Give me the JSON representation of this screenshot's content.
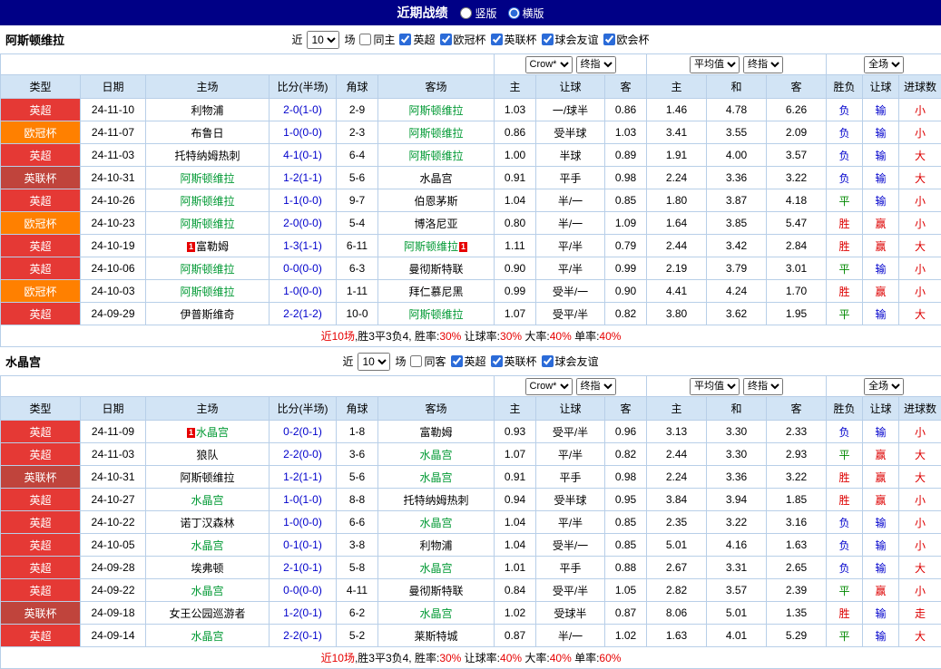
{
  "top_bar": {
    "title": "近期战绩",
    "radios": [
      {
        "label": "竖版",
        "selected": false
      },
      {
        "label": "横版",
        "selected": true
      }
    ]
  },
  "table_columns": {
    "type": "类型",
    "date": "日期",
    "home": "主场",
    "score": "比分(半场)",
    "corners": "角球",
    "away": "客场",
    "handicap_group": [
      "主",
      "让球",
      "客"
    ],
    "europe_group": [
      "主",
      "和",
      "客"
    ],
    "result_group": [
      "胜负",
      "让球",
      "进球数"
    ]
  },
  "colors": {
    "leagues": {
      "英超": "#e53935",
      "欧冠杯": "#ff8000",
      "英联杯": "#c0443c"
    },
    "focus_team_green": "#009933",
    "score_blue": "#0000cc",
    "win_red": "#dd0000",
    "draw_green": "#008800",
    "lose_blue": "#0000cc",
    "red_text": "#e60000",
    "topbar_navy": "#000086",
    "header_blue": "#d2e4f5"
  },
  "sections": [
    {
      "team": "阿斯顿维拉",
      "filter": {
        "prefix": "近",
        "count": "10",
        "suffix": "场",
        "same_option": {
          "label": "同主",
          "checked": false
        },
        "leagues": [
          {
            "label": "英超",
            "checked": true
          },
          {
            "label": "欧冠杯",
            "checked": true
          },
          {
            "label": "英联杯",
            "checked": true
          },
          {
            "label": "球会友谊",
            "checked": true
          },
          {
            "label": "欧会杯",
            "checked": true
          }
        ]
      },
      "selects": {
        "handicap_company": "Crow*",
        "handicap_stage": "终指",
        "europe_company": "平均值",
        "europe_stage": "终指",
        "scope": "全场"
      },
      "rows": [
        {
          "league": "英超",
          "date": "24-11-10",
          "home": {
            "name": "利物浦"
          },
          "score": "2-0(1-0)",
          "corners": "2-9",
          "away": {
            "name": "阿斯顿维拉",
            "focus": true
          },
          "handicap": [
            "1.03",
            "一/球半",
            "0.86"
          ],
          "europe": [
            "1.46",
            "4.78",
            "6.26"
          ],
          "result": [
            [
              "负",
              "b"
            ],
            [
              "输",
              "b"
            ],
            [
              "小",
              "r"
            ]
          ]
        },
        {
          "league": "欧冠杯",
          "date": "24-11-07",
          "home": {
            "name": "布鲁日"
          },
          "score": "1-0(0-0)",
          "corners": "2-3",
          "away": {
            "name": "阿斯顿维拉",
            "focus": true
          },
          "handicap": [
            "0.86",
            "受半球",
            "1.03"
          ],
          "europe": [
            "3.41",
            "3.55",
            "2.09"
          ],
          "result": [
            [
              "负",
              "b"
            ],
            [
              "输",
              "b"
            ],
            [
              "小",
              "r"
            ]
          ]
        },
        {
          "league": "英超",
          "date": "24-11-03",
          "home": {
            "name": "托特纳姆热刺"
          },
          "score": "4-1(0-1)",
          "corners": "6-4",
          "away": {
            "name": "阿斯顿维拉",
            "focus": true
          },
          "handicap": [
            "1.00",
            "半球",
            "0.89"
          ],
          "europe": [
            "1.91",
            "4.00",
            "3.57"
          ],
          "result": [
            [
              "负",
              "b"
            ],
            [
              "输",
              "b"
            ],
            [
              "大",
              "r"
            ]
          ]
        },
        {
          "league": "英联杯",
          "date": "24-10-31",
          "home": {
            "name": "阿斯顿维拉",
            "focus": true
          },
          "score": "1-2(1-1)",
          "corners": "5-6",
          "away": {
            "name": "水晶宫"
          },
          "handicap": [
            "0.91",
            "平手",
            "0.98"
          ],
          "europe": [
            "2.24",
            "3.36",
            "3.22"
          ],
          "result": [
            [
              "负",
              "b"
            ],
            [
              "输",
              "b"
            ],
            [
              "大",
              "r"
            ]
          ]
        },
        {
          "league": "英超",
          "date": "24-10-26",
          "home": {
            "name": "阿斯顿维拉",
            "focus": true
          },
          "score": "1-1(0-0)",
          "corners": "9-7",
          "away": {
            "name": "伯恩茅斯"
          },
          "handicap": [
            "1.04",
            "半/一",
            "0.85"
          ],
          "europe": [
            "1.80",
            "3.87",
            "4.18"
          ],
          "result": [
            [
              "平",
              "g"
            ],
            [
              "输",
              "b"
            ],
            [
              "小",
              "r"
            ]
          ]
        },
        {
          "league": "欧冠杯",
          "date": "24-10-23",
          "home": {
            "name": "阿斯顿维拉",
            "focus": true
          },
          "score": "2-0(0-0)",
          "corners": "5-4",
          "away": {
            "name": "博洛尼亚"
          },
          "handicap": [
            "0.80",
            "半/一",
            "1.09"
          ],
          "europe": [
            "1.64",
            "3.85",
            "5.47"
          ],
          "result": [
            [
              "胜",
              "r"
            ],
            [
              "赢",
              "r"
            ],
            [
              "小",
              "r"
            ]
          ]
        },
        {
          "league": "英超",
          "date": "24-10-19",
          "home": {
            "name": "富勒姆",
            "card": "before"
          },
          "score": "1-3(1-1)",
          "corners": "6-11",
          "away": {
            "name": "阿斯顿维拉",
            "focus": true,
            "card": "after"
          },
          "handicap": [
            "1.11",
            "平/半",
            "0.79"
          ],
          "europe": [
            "2.44",
            "3.42",
            "2.84"
          ],
          "result": [
            [
              "胜",
              "r"
            ],
            [
              "赢",
              "r"
            ],
            [
              "大",
              "r"
            ]
          ]
        },
        {
          "league": "英超",
          "date": "24-10-06",
          "home": {
            "name": "阿斯顿维拉",
            "focus": true
          },
          "score": "0-0(0-0)",
          "corners": "6-3",
          "away": {
            "name": "曼彻斯特联"
          },
          "handicap": [
            "0.90",
            "平/半",
            "0.99"
          ],
          "europe": [
            "2.19",
            "3.79",
            "3.01"
          ],
          "result": [
            [
              "平",
              "g"
            ],
            [
              "输",
              "b"
            ],
            [
              "小",
              "r"
            ]
          ]
        },
        {
          "league": "欧冠杯",
          "date": "24-10-03",
          "home": {
            "name": "阿斯顿维拉",
            "focus": true
          },
          "score": "1-0(0-0)",
          "corners": "1-11",
          "away": {
            "name": "拜仁慕尼黑"
          },
          "handicap": [
            "0.99",
            "受半/一",
            "0.90"
          ],
          "europe": [
            "4.41",
            "4.24",
            "1.70"
          ],
          "result": [
            [
              "胜",
              "r"
            ],
            [
              "赢",
              "r"
            ],
            [
              "小",
              "r"
            ]
          ]
        },
        {
          "league": "英超",
          "date": "24-09-29",
          "home": {
            "name": "伊普斯维奇"
          },
          "score": "2-2(1-2)",
          "corners": "10-0",
          "away": {
            "name": "阿斯顿维拉",
            "focus": true
          },
          "handicap": [
            "1.07",
            "受平/半",
            "0.82"
          ],
          "europe": [
            "3.80",
            "3.62",
            "1.95"
          ],
          "result": [
            [
              "平",
              "g"
            ],
            [
              "输",
              "b"
            ],
            [
              "大",
              "r"
            ]
          ]
        }
      ],
      "summary": [
        [
          "近10场",
          true
        ],
        [
          ",胜3平3负4, 胜率:",
          false
        ],
        [
          "30%",
          true
        ],
        [
          " 让球率:",
          false
        ],
        [
          "30%",
          true
        ],
        [
          " 大率:",
          false
        ],
        [
          "40%",
          true
        ],
        [
          " 单率:",
          false
        ],
        [
          "40%",
          true
        ]
      ]
    },
    {
      "team": "水晶宫",
      "filter": {
        "prefix": "近",
        "count": "10",
        "suffix": "场",
        "same_option": {
          "label": "同客",
          "checked": false
        },
        "leagues": [
          {
            "label": "英超",
            "checked": true
          },
          {
            "label": "英联杯",
            "checked": true
          },
          {
            "label": "球会友谊",
            "checked": true
          }
        ]
      },
      "selects": {
        "handicap_company": "Crow*",
        "handicap_stage": "终指",
        "europe_company": "平均值",
        "europe_stage": "终指",
        "scope": "全场"
      },
      "rows": [
        {
          "league": "英超",
          "date": "24-11-09",
          "home": {
            "name": "水晶宫",
            "focus": true,
            "card": "before"
          },
          "score": "0-2(0-1)",
          "corners": "1-8",
          "away": {
            "name": "富勒姆"
          },
          "handicap": [
            "0.93",
            "受平/半",
            "0.96"
          ],
          "europe": [
            "3.13",
            "3.30",
            "2.33"
          ],
          "result": [
            [
              "负",
              "b"
            ],
            [
              "输",
              "b"
            ],
            [
              "小",
              "r"
            ]
          ]
        },
        {
          "league": "英超",
          "date": "24-11-03",
          "home": {
            "name": "狼队"
          },
          "score": "2-2(0-0)",
          "corners": "3-6",
          "away": {
            "name": "水晶宫",
            "focus": true
          },
          "handicap": [
            "1.07",
            "平/半",
            "0.82"
          ],
          "europe": [
            "2.44",
            "3.30",
            "2.93"
          ],
          "result": [
            [
              "平",
              "g"
            ],
            [
              "赢",
              "r"
            ],
            [
              "大",
              "r"
            ]
          ]
        },
        {
          "league": "英联杯",
          "date": "24-10-31",
          "home": {
            "name": "阿斯顿维拉"
          },
          "score": "1-2(1-1)",
          "corners": "5-6",
          "away": {
            "name": "水晶宫",
            "focus": true
          },
          "handicap": [
            "0.91",
            "平手",
            "0.98"
          ],
          "europe": [
            "2.24",
            "3.36",
            "3.22"
          ],
          "result": [
            [
              "胜",
              "r"
            ],
            [
              "赢",
              "r"
            ],
            [
              "大",
              "r"
            ]
          ]
        },
        {
          "league": "英超",
          "date": "24-10-27",
          "home": {
            "name": "水晶宫",
            "focus": true
          },
          "score": "1-0(1-0)",
          "corners": "8-8",
          "away": {
            "name": "托特纳姆热刺"
          },
          "handicap": [
            "0.94",
            "受半球",
            "0.95"
          ],
          "europe": [
            "3.84",
            "3.94",
            "1.85"
          ],
          "result": [
            [
              "胜",
              "r"
            ],
            [
              "赢",
              "r"
            ],
            [
              "小",
              "r"
            ]
          ]
        },
        {
          "league": "英超",
          "date": "24-10-22",
          "home": {
            "name": "诺丁汉森林"
          },
          "score": "1-0(0-0)",
          "corners": "6-6",
          "away": {
            "name": "水晶宫",
            "focus": true
          },
          "handicap": [
            "1.04",
            "平/半",
            "0.85"
          ],
          "europe": [
            "2.35",
            "3.22",
            "3.16"
          ],
          "result": [
            [
              "负",
              "b"
            ],
            [
              "输",
              "b"
            ],
            [
              "小",
              "r"
            ]
          ]
        },
        {
          "league": "英超",
          "date": "24-10-05",
          "home": {
            "name": "水晶宫",
            "focus": true
          },
          "score": "0-1(0-1)",
          "corners": "3-8",
          "away": {
            "name": "利物浦"
          },
          "handicap": [
            "1.04",
            "受半/一",
            "0.85"
          ],
          "europe": [
            "5.01",
            "4.16",
            "1.63"
          ],
          "result": [
            [
              "负",
              "b"
            ],
            [
              "输",
              "b"
            ],
            [
              "小",
              "r"
            ]
          ]
        },
        {
          "league": "英超",
          "date": "24-09-28",
          "home": {
            "name": "埃弗顿"
          },
          "score": "2-1(0-1)",
          "corners": "5-8",
          "away": {
            "name": "水晶宫",
            "focus": true
          },
          "handicap": [
            "1.01",
            "平手",
            "0.88"
          ],
          "europe": [
            "2.67",
            "3.31",
            "2.65"
          ],
          "result": [
            [
              "负",
              "b"
            ],
            [
              "输",
              "b"
            ],
            [
              "大",
              "r"
            ]
          ]
        },
        {
          "league": "英超",
          "date": "24-09-22",
          "home": {
            "name": "水晶宫",
            "focus": true
          },
          "score": "0-0(0-0)",
          "corners": "4-11",
          "away": {
            "name": "曼彻斯特联"
          },
          "handicap": [
            "0.84",
            "受平/半",
            "1.05"
          ],
          "europe": [
            "2.82",
            "3.57",
            "2.39"
          ],
          "result": [
            [
              "平",
              "g"
            ],
            [
              "赢",
              "r"
            ],
            [
              "小",
              "r"
            ]
          ]
        },
        {
          "league": "英联杯",
          "date": "24-09-18",
          "home": {
            "name": "女王公园巡游者"
          },
          "score": "1-2(0-1)",
          "corners": "6-2",
          "away": {
            "name": "水晶宫",
            "focus": true
          },
          "handicap": [
            "1.02",
            "受球半",
            "0.87"
          ],
          "europe": [
            "8.06",
            "5.01",
            "1.35"
          ],
          "result": [
            [
              "胜",
              "r"
            ],
            [
              "输",
              "b"
            ],
            [
              "走",
              "r"
            ]
          ]
        },
        {
          "league": "英超",
          "date": "24-09-14",
          "home": {
            "name": "水晶宫",
            "focus": true
          },
          "score": "2-2(0-1)",
          "corners": "5-2",
          "away": {
            "name": "莱斯特城"
          },
          "handicap": [
            "0.87",
            "半/一",
            "1.02"
          ],
          "europe": [
            "1.63",
            "4.01",
            "5.29"
          ],
          "result": [
            [
              "平",
              "g"
            ],
            [
              "输",
              "b"
            ],
            [
              "大",
              "r"
            ]
          ]
        }
      ],
      "summary": [
        [
          "近10场",
          true
        ],
        [
          ",胜3平3负4, 胜率:",
          false
        ],
        [
          "30%",
          true
        ],
        [
          " 让球率:",
          false
        ],
        [
          "40%",
          true
        ],
        [
          " 大率:",
          false
        ],
        [
          "40%",
          true
        ],
        [
          " 单率:",
          false
        ],
        [
          "60%",
          true
        ]
      ]
    }
  ]
}
